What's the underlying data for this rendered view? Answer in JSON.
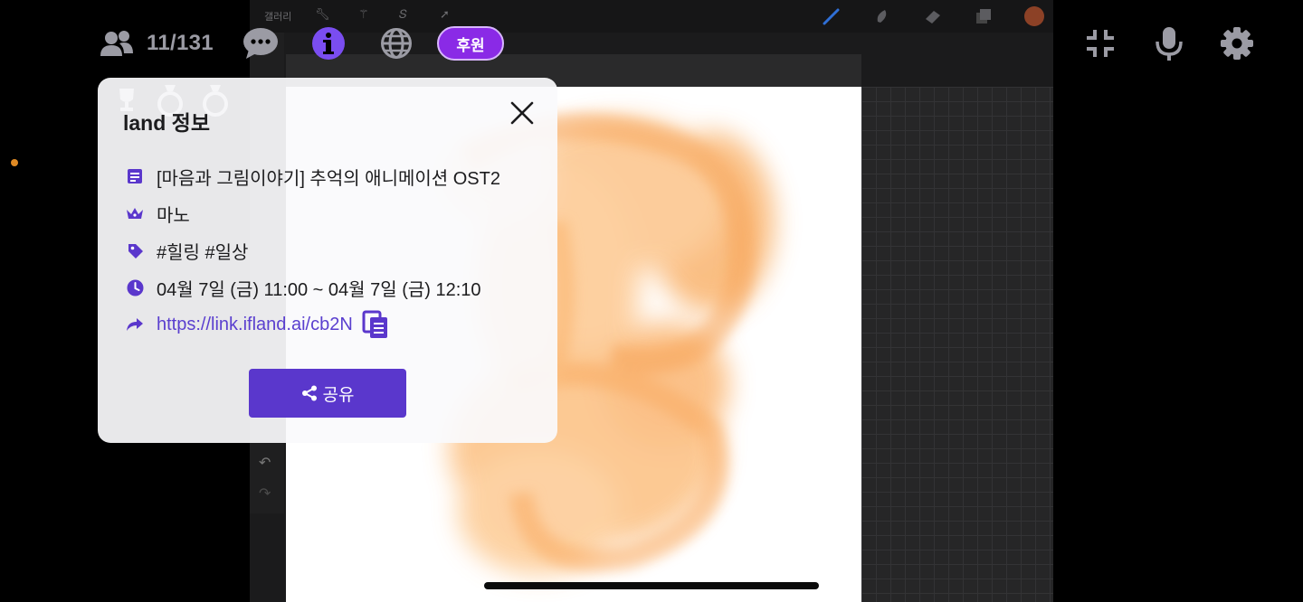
{
  "hud": {
    "user_count": "11/131",
    "sponsor_label": "후원"
  },
  "background_app": {
    "gallery_label": "갤러리",
    "color_swatch": "#b4502c"
  },
  "dialog": {
    "title": "land 정보",
    "room_title": "[마음과 그림이야기] 추억의 애니메이션 OST2",
    "host": "마노",
    "tags": "#힐링 #일상",
    "schedule": "04월 7일 (금) 11:00 ~ 04월 7일 (금) 12:10",
    "link": "https://link.ifland.ai/cb2N",
    "share_label": "공유"
  },
  "colors": {
    "accent": "#5a37cc",
    "sponsor": "#8a2ae6",
    "link": "#5a3fcf",
    "icon_gray": "#9b9ba4"
  },
  "icons": [
    "users-icon",
    "chat-icon",
    "info-icon",
    "globe-icon",
    "minimize-icon",
    "mic-icon",
    "gear-icon",
    "close-icon",
    "document-icon",
    "crown-icon",
    "tag-icon",
    "clock-icon",
    "share-arrow-icon",
    "copy-icon",
    "share-icon"
  ]
}
